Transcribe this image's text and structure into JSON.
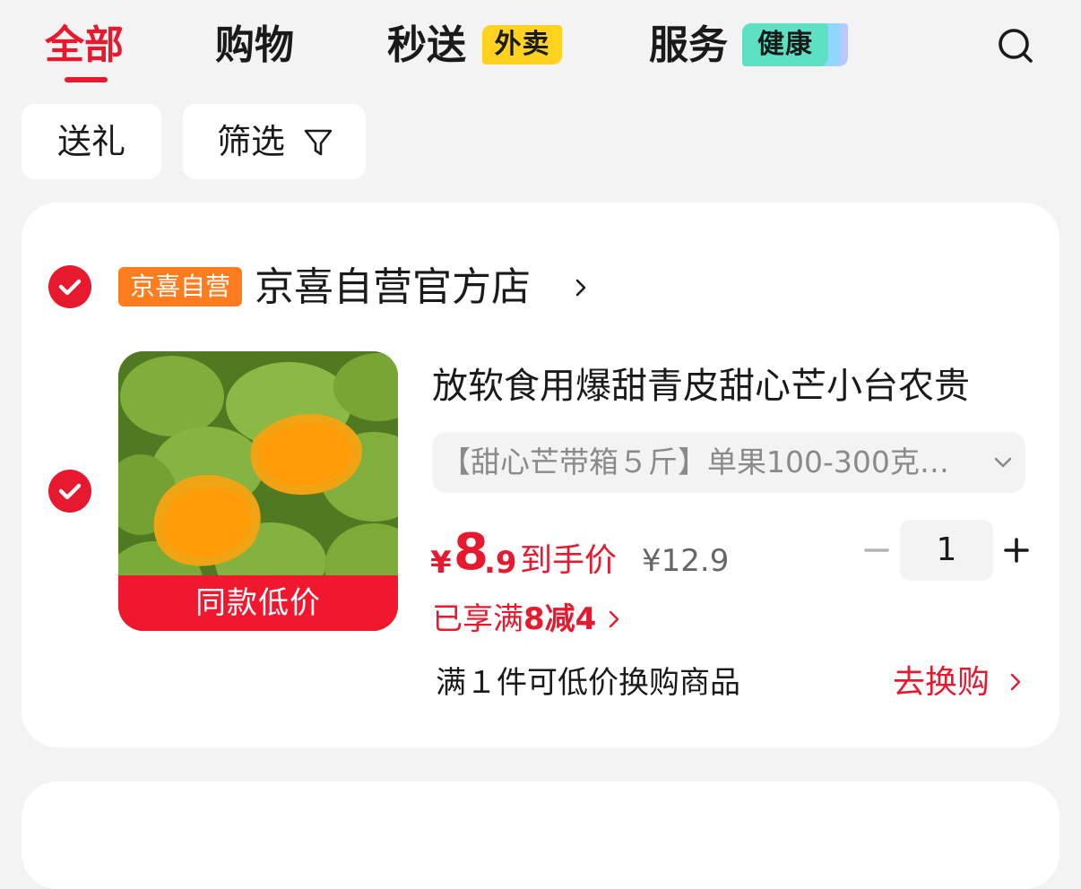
{
  "tabs": [
    {
      "label": "全部",
      "active": true
    },
    {
      "label": "购物"
    },
    {
      "label": "秒送",
      "badge": "外卖"
    },
    {
      "label": "服务",
      "badge": "健康"
    }
  ],
  "icons": {
    "search": "search-icon",
    "filter": "filter-icon",
    "check": "checkmark-circle-icon",
    "chevron_right": "chevron-right-icon",
    "chevron_down": "chevron-down-icon",
    "minus": "minus-icon",
    "plus": "plus-icon"
  },
  "filters": {
    "gift": "送礼",
    "filter": "筛选"
  },
  "store": {
    "checked": true,
    "tag": "京喜自营",
    "name": "京喜自营官方店"
  },
  "item": {
    "checked": true,
    "image_banner": "同款低价",
    "title": "放软食用爆甜青皮甜心芒小台农贵",
    "spec": "【甜心芒带箱５斤】单果100-300克…",
    "price": {
      "currency": "¥",
      "integer": "8",
      "decimal": ".9",
      "label": "到手价"
    },
    "original_price": "¥12.9",
    "quantity": "1",
    "promo_prefix": "已享满",
    "promo_bold": "8减4",
    "exchange_text": "满１件可低价换购商品",
    "exchange_link": "去换购"
  },
  "colors": {
    "accent": "#e6192e",
    "store_tag": "#ff7d1f",
    "takeout_badge": "#ffd21f",
    "health_badge": "#5ee0c2",
    "background": "#f3f3f3"
  }
}
